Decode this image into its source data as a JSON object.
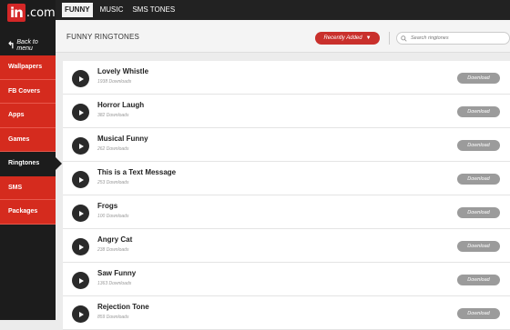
{
  "logo": {
    "brand": "in",
    "suffix": ".com"
  },
  "sidebar": {
    "back_label": "Back to menu",
    "items": [
      {
        "label": "Wallpapers",
        "active": false
      },
      {
        "label": "FB Covers",
        "active": false
      },
      {
        "label": "Apps",
        "active": false
      },
      {
        "label": "Games",
        "active": false
      },
      {
        "label": "Ringtones",
        "active": true
      },
      {
        "label": "SMS",
        "active": false
      },
      {
        "label": "Packages",
        "active": false
      }
    ]
  },
  "topbar": {
    "tabs": [
      {
        "label": "FUNNY",
        "active": true
      },
      {
        "label": "MUSIC",
        "active": false
      },
      {
        "label": "SMS TONES",
        "active": false
      }
    ]
  },
  "header": {
    "title": "FUNNY RINGTONES",
    "sort_label": "Recently Added",
    "search_placeholder": "Search ringtones"
  },
  "download_label": "Download",
  "ringtones": [
    {
      "title": "Lovely Whistle",
      "downloads": "1938 Downloads"
    },
    {
      "title": "Horror Laugh",
      "downloads": "382 Downloads"
    },
    {
      "title": "Musical Funny",
      "downloads": "262 Downloads"
    },
    {
      "title": "This is a Text Message",
      "downloads": "253 Downloads"
    },
    {
      "title": "Frogs",
      "downloads": "100 Downloads"
    },
    {
      "title": "Angry Cat",
      "downloads": "238 Downloads"
    },
    {
      "title": "Saw Funny",
      "downloads": "1363 Downloads"
    },
    {
      "title": "Rejection Tone",
      "downloads": "859 Downloads"
    }
  ],
  "colors": {
    "accent": "#d52b1e",
    "dark": "#1c1c1c",
    "button": "#9b9b9b"
  }
}
